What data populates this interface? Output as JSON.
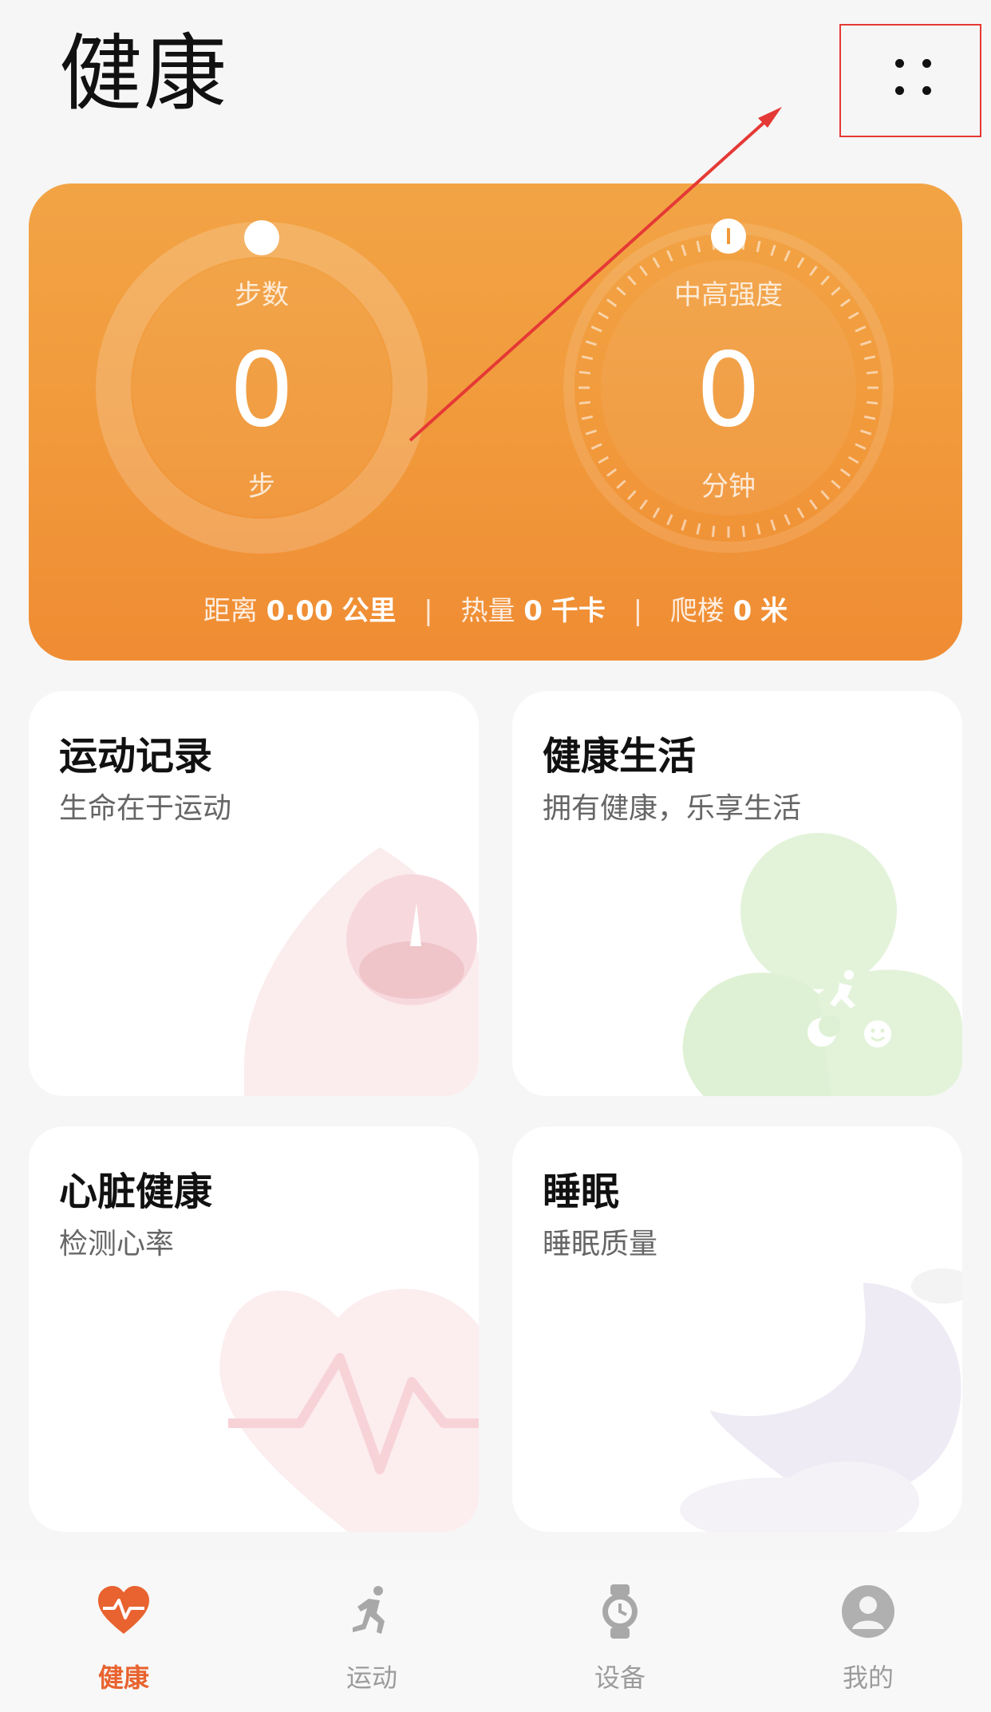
{
  "header": {
    "title": "健康"
  },
  "activity": {
    "steps": {
      "label": "步数",
      "value": "0",
      "unit": "步"
    },
    "intensity": {
      "label": "中高强度",
      "value": "0",
      "unit": "分钟"
    },
    "stats": [
      {
        "label": "距离",
        "value": "0.00",
        "unit": "公里"
      },
      {
        "label": "热量",
        "value": "0",
        "unit": "千卡"
      },
      {
        "label": "爬楼",
        "value": "0",
        "unit": "米"
      }
    ]
  },
  "cards": [
    {
      "title": "运动记录",
      "subtitle": "生命在于运动"
    },
    {
      "title": "健康生活",
      "subtitle": "拥有健康，乐享生活"
    },
    {
      "title": "心脏健康",
      "subtitle": "检测心率"
    },
    {
      "title": "睡眠",
      "subtitle": "睡眠质量"
    }
  ],
  "nav": [
    {
      "label": "健康",
      "icon": "heart-pulse-icon",
      "active": true
    },
    {
      "label": "运动",
      "icon": "running-icon",
      "active": false
    },
    {
      "label": "设备",
      "icon": "watch-icon",
      "active": false
    },
    {
      "label": "我的",
      "icon": "profile-icon",
      "active": false
    }
  ],
  "colors": {
    "accent": "#e8632f",
    "card_orange": "#f19a3c",
    "annotation_red": "#e53935"
  },
  "icons": {
    "more": "more-dots-icon"
  }
}
